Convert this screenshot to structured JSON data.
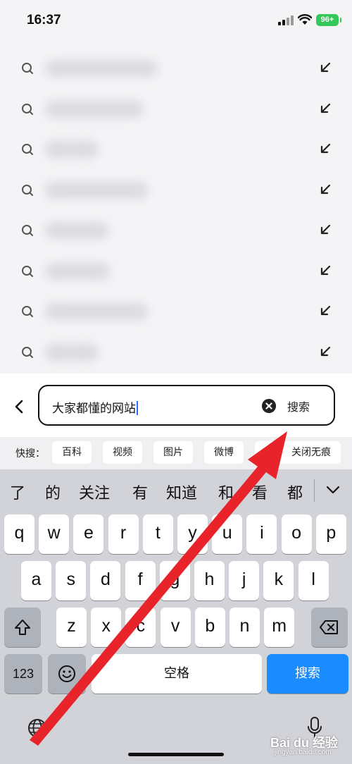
{
  "status_bar": {
    "time": "16:37",
    "battery": "96+"
  },
  "suggestions": {
    "count": 8
  },
  "search": {
    "query": "大家都懂的网站",
    "search_label": "搜索"
  },
  "quick_search": {
    "label": "快搜：",
    "chips": [
      "百科",
      "视频",
      "图片",
      "微博",
      "关闭无痕"
    ]
  },
  "keyboard": {
    "candidates": [
      "了",
      "的",
      "关注",
      "有",
      "知道",
      "和",
      "看",
      "都"
    ],
    "row1": [
      "q",
      "w",
      "e",
      "r",
      "t",
      "y",
      "u",
      "i",
      "o",
      "p"
    ],
    "row2": [
      "a",
      "s",
      "d",
      "f",
      "g",
      "h",
      "j",
      "k",
      "l"
    ],
    "row3": [
      "z",
      "x",
      "c",
      "v",
      "b",
      "n",
      "m"
    ],
    "numbers_key": "123",
    "space_label": "空格",
    "return_label": "搜索"
  },
  "watermark": {
    "logo": "Bai du 经验",
    "url": "jingyan.baidu.com"
  },
  "colors": {
    "accent": "#1a8cff",
    "annotation_arrow": "#e8232a",
    "battery": "#34c759"
  }
}
